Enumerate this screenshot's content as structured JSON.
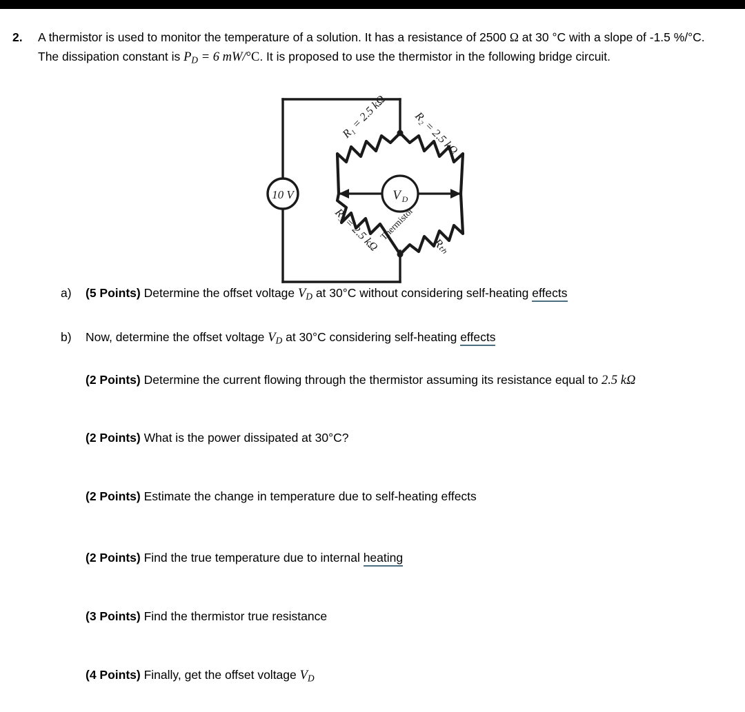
{
  "document": {
    "top_bar_color": "#000000",
    "background_color": "#ffffff",
    "spellcheck_underline_color": "#4a6e80"
  },
  "question": {
    "number": "2.",
    "text_part_1": "A thermistor is used to monitor the temperature of a solution. It has a resistance of 2500 ",
    "ohm_symbol": "Ω",
    "text_part_2": " at 30 °C with a slope of -1.5 %/°C. The dissipation constant is ",
    "pd_symbol": "P",
    "pd_subscript": "D",
    "pd_equation": " = 6 mW/",
    "pd_unit": "°C",
    "text_part_3": ". It is proposed to use the thermistor in the following bridge circuit."
  },
  "figure": {
    "name": "wheatstone-bridge-circuit",
    "source_label": "10 V",
    "r1_label": "R₁ = 2.5 kΩ",
    "r2_label": "R₂ = 2.5 kΩ",
    "r3_label": "R₃ = 2.5 kΩ",
    "thermistor_label": "Thermistor",
    "rth_label": "Rₜₕ",
    "meter_label": "V",
    "meter_subscript": "D"
  },
  "sub_questions": [
    {
      "marker": "a)",
      "points": "(5 Points)",
      "text_before": " Determine the offset voltage ",
      "var": "V",
      "var_sub": "D",
      "text_middle": " at 30°C without considering self-heating ",
      "spell_word": "effects"
    },
    {
      "marker": "b)",
      "points": "",
      "text_before": "Now, determine the offset voltage ",
      "var": "V",
      "var_sub": "D",
      "text_middle": " at 30°C considering self-heating ",
      "spell_word": "effects"
    }
  ],
  "tasks": [
    {
      "points": "(2 Points)",
      "text": " Determine the current flowing through  the  thermistor  assuming its resistance equal to ",
      "math_tail": "2.5 kΩ",
      "spell_word": "",
      "has_math_tail": true
    },
    {
      "points": "(2 Points)",
      "text": " What is  the power dissipated at 30°C?",
      "spell_word": "",
      "has_math_tail": false
    },
    {
      "points": "(2 Points)",
      "text": " Estimate the change in temperature due to self-heating effects",
      "spell_word": "",
      "has_math_tail": false
    },
    {
      "points": "(2 Points)",
      "text": " Find the true temperature due to internal ",
      "spell_word": "heating",
      "has_math_tail": false
    },
    {
      "points": "(3 Points)",
      "text": " Find the thermistor true resistance",
      "spell_word": "",
      "has_math_tail": false
    },
    {
      "points": "(4 Points)",
      "text": " Finally, get the offset voltage ",
      "spell_word": "",
      "has_math_tail": false,
      "var": "V",
      "var_sub": "D"
    }
  ]
}
